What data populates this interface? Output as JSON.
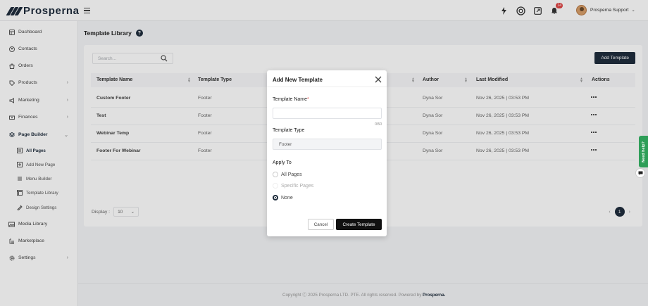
{
  "brand": {
    "name": "Prosperna"
  },
  "topbar": {
    "notifications_count": "24",
    "user_name": "Prosperna Support"
  },
  "sidebar": {
    "items": [
      {
        "label": "Dashboard",
        "icon": "dashboard-icon"
      },
      {
        "label": "Contacts",
        "icon": "contacts-icon"
      },
      {
        "label": "Orders",
        "icon": "orders-icon"
      },
      {
        "label": "Products",
        "icon": "products-icon"
      },
      {
        "label": "Marketing",
        "icon": "marketing-icon"
      },
      {
        "label": "Finances",
        "icon": "finances-icon"
      },
      {
        "label": "Page Builder",
        "icon": "page-builder-icon"
      },
      {
        "label": "Media Library",
        "icon": "media-library-icon"
      },
      {
        "label": "Marketplace",
        "icon": "marketplace-icon"
      },
      {
        "label": "Settings",
        "icon": "settings-icon"
      }
    ],
    "page_builder_sub": [
      {
        "label": "All Pages"
      },
      {
        "label": "Add New Page"
      },
      {
        "label": "Menu Builder"
      },
      {
        "label": "Template Library"
      },
      {
        "label": "Design Settings"
      }
    ]
  },
  "page": {
    "title": "Template Library",
    "search_placeholder": "Search...",
    "add_button": "Add Template",
    "columns": [
      "Template Name",
      "Template Type",
      "Author",
      "Last Modified",
      "Actions"
    ],
    "rows": [
      {
        "name": "Custom Footer",
        "type": "Footer",
        "author": "Dyna Sor",
        "modified": "Nov 26, 2025 | 03:53 PM"
      },
      {
        "name": "Test",
        "type": "Footer",
        "author": "Dyna Sor",
        "modified": "Nov 26, 2025 | 03:53 PM"
      },
      {
        "name": "Webinar Temp",
        "type": "Footer",
        "author": "Dyna Sor",
        "modified": "Nov 26, 2025 | 03:53 PM"
      },
      {
        "name": "Footer For Webinar",
        "type": "Footer",
        "author": "Dyna Sor",
        "modified": "Nov 26, 2025 | 03:53 PM"
      }
    ],
    "display_label": "Display :",
    "display_value": "10",
    "current_page": "1"
  },
  "footer": {
    "text": "Copyright ⓒ 2025 Prosperna LTD. PTE. All rights reserved. Powered by",
    "brand": "Prosperna."
  },
  "help_widget": {
    "label": "Need help?"
  },
  "modal": {
    "title": "Add New Template",
    "name_label": "Template Name",
    "name_value": "",
    "name_counter": "0/50",
    "type_label": "Template Type",
    "type_value": "Footer",
    "apply_label": "Apply To",
    "options": [
      {
        "label": "All Pages",
        "state": "unchecked"
      },
      {
        "label": "Specific Pages",
        "state": "disabled"
      },
      {
        "label": "None",
        "state": "checked"
      }
    ],
    "cancel_label": "Cancel",
    "create_label": "Create Template"
  },
  "colors": {
    "primary": "#1f2d3d",
    "danger": "#e04545",
    "help_green": "#2e9e58"
  }
}
